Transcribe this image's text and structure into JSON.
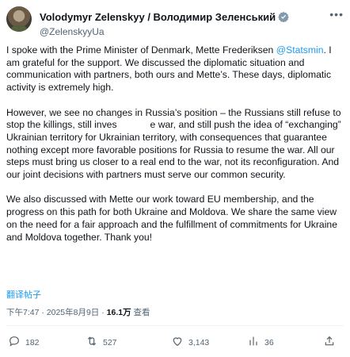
{
  "author": {
    "name": "Volodymyr Zelenskyy / Володимир Зеленський",
    "handle": "@ZelenskyyUa"
  },
  "tweet": {
    "p1_before": "I spoke with the Prime Minister of Denmark, Mette Frederiksen ",
    "p1_mention": "@Statsmin",
    "p1_after": ". I am grateful for the support. We discussed the diplomatic situation and communication with partners, both ours and Mette’s. These days, diplomatic activity is extremely high.",
    "p2_before": "However, we see no changes in Russia’s position – the Russians still refuse to stop the killings, still inves",
    "p2_after": "e war, and still push the idea of “exchanging” Ukrainian territory for Ukrainian territory, with consequences that guarantee nothing except more favorable positions for Russia to resume the war. All our steps must bring us closer to a real end to the war, not its reconfiguration. And our joint decisions with partners must serve our common security.",
    "p3": "We also discussed with Mette our work toward EU membership, and the progress on this path for both Ukraine and Moldova. We share the same view on the need for a fair approach and the fulfillment of commitments for Ukraine and Moldova together. Thank you!",
    "translate_label": "翻译帖子"
  },
  "meta": {
    "time": "下午7:47 · 2025年8月9日 · ",
    "views_count": "16.1万",
    "views_label": " 查看"
  },
  "actions": {
    "replies": "182",
    "reposts": "527",
    "likes": "3,143",
    "bookmarks": "36"
  },
  "colors": {
    "accent": "#1d9bf0",
    "text": "#0f1419",
    "secondary": "#536471",
    "verified": "#829aab"
  }
}
